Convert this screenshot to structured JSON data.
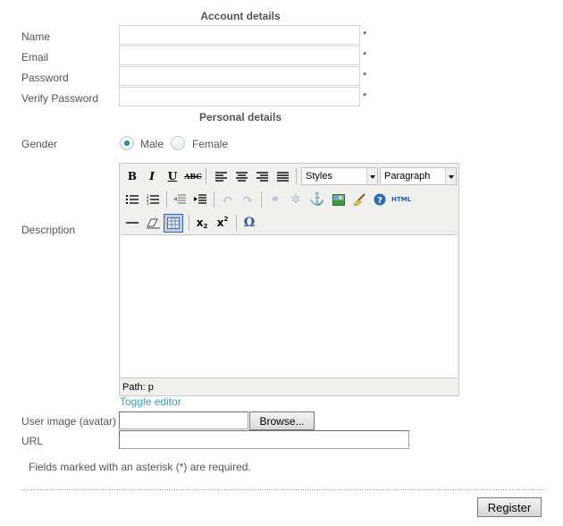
{
  "account": {
    "title": "Account details",
    "fields": [
      {
        "label": "Name",
        "value": "",
        "required": "*"
      },
      {
        "label": "Email",
        "value": "",
        "required": "*"
      },
      {
        "label": "Password",
        "value": "",
        "required": "*"
      },
      {
        "label": "Verify Password",
        "value": "",
        "required": "*"
      }
    ]
  },
  "personal": {
    "title": "Personal details",
    "gender_label": "Gender",
    "gender_options": [
      "Male",
      "Female"
    ],
    "gender_selected": "Male",
    "description_label": "Description"
  },
  "editor": {
    "toolbar_row1": [
      "bold-icon",
      "italic-icon",
      "underline-icon",
      "strikethrough-icon",
      "align-left-icon",
      "align-center-icon",
      "align-right-icon",
      "align-justify-icon"
    ],
    "styles_value": "Styles",
    "format_value": "Paragraph",
    "toolbar_row2": [
      "bullet-list-icon",
      "numbered-list-icon",
      "outdent-icon",
      "indent-icon",
      "undo-icon",
      "redo-icon",
      "link-icon",
      "unlink-icon",
      "anchor-icon",
      "image-icon",
      "cleanup-icon",
      "help-icon",
      "html-icon"
    ],
    "toolbar_row3": [
      "horizontal-rule-icon",
      "remove-format-icon",
      "visual-aid-icon",
      "subscript-icon",
      "superscript-icon",
      "special-char-icon"
    ],
    "path_text": "Path: p",
    "toggle_label": "Toggle editor",
    "html_label": "HTML",
    "omega": "Ω"
  },
  "avatar": {
    "label": "User image (avatar)",
    "browse_label": "Browse..."
  },
  "url": {
    "label": "URL",
    "value": ""
  },
  "note": "Fields marked with an asterisk (*) are required.",
  "register_label": "Register"
}
